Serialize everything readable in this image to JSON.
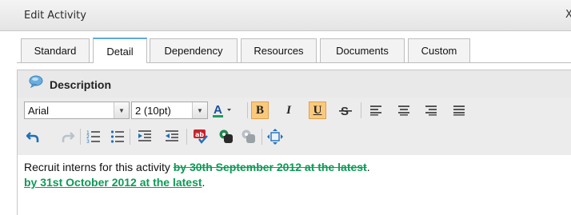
{
  "dialog": {
    "title": "Edit Activity",
    "close_glyph": "X"
  },
  "tabs": [
    {
      "label": "Standard"
    },
    {
      "label": "Detail",
      "active": true
    },
    {
      "label": "Dependency"
    },
    {
      "label": "Resources"
    },
    {
      "label": "Documents"
    },
    {
      "label": "Custom"
    }
  ],
  "description": {
    "heading": "Description",
    "toolbar": {
      "font_family": "Arial",
      "font_size": "2 (10pt)",
      "bold_active": true,
      "underline_active": true
    },
    "content": {
      "plain": "Recruit interns for this activity ",
      "deleted": "by 30th September 2012 at the latest",
      "after_deleted": ".",
      "inserted": "by 31st October 2012 at the latest",
      "after_inserted": "."
    }
  },
  "colors": {
    "accent": "#5ea9dd",
    "tracked_change": "#0e9a56",
    "active_button": "#fbc97c"
  }
}
